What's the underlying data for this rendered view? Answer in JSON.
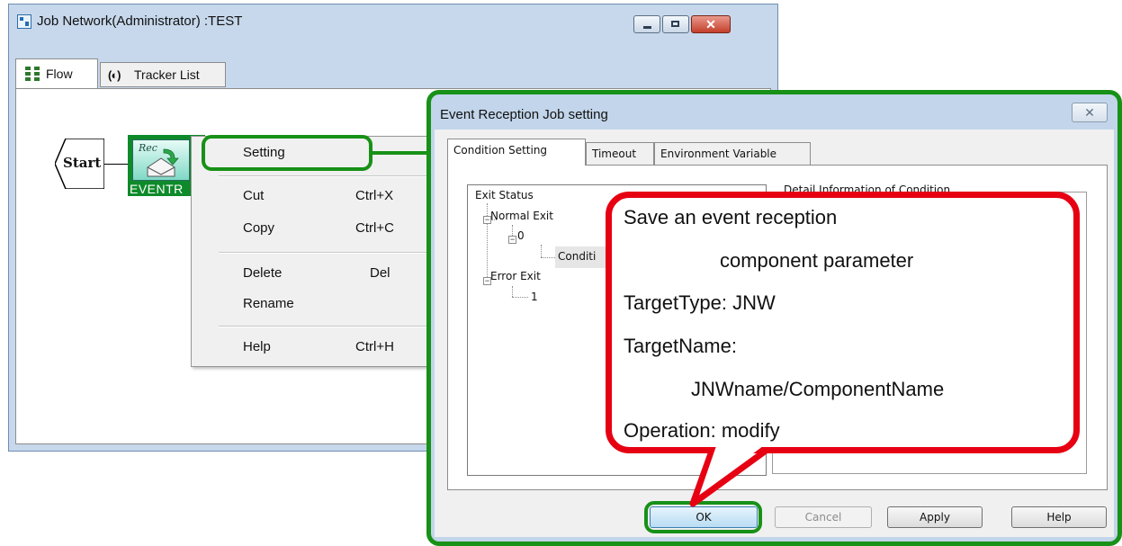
{
  "main_window": {
    "title": "Job Network(Administrator) :TEST",
    "close_glyph": "✕",
    "tabs": [
      {
        "label": "Flow"
      },
      {
        "label": "Tracker List",
        "icon_glyph": "(◐)"
      }
    ],
    "flow": {
      "start_label": "Start",
      "event_icon_text": "Rec",
      "event_label": "EVENTR"
    }
  },
  "context_menu": {
    "items": [
      {
        "label": "Setting",
        "shortcut": ""
      },
      {
        "label": "Cut",
        "shortcut": "Ctrl+X"
      },
      {
        "label": "Copy",
        "shortcut": "Ctrl+C"
      },
      {
        "label": "Delete",
        "shortcut": "Del"
      },
      {
        "label": "Rename",
        "shortcut": ""
      },
      {
        "label": "Help",
        "shortcut": "Ctrl+H"
      }
    ]
  },
  "dialog": {
    "title": "Event Reception Job setting",
    "close_glyph": "✕",
    "tabs": [
      {
        "label": "Condition Setting"
      },
      {
        "label": "Timeout"
      },
      {
        "label": "Environment Variable"
      }
    ],
    "tree": {
      "root": "Exit Status",
      "normal_exit": "Normal Exit",
      "normal_code": "0",
      "condition": "Conditi",
      "error_exit": "Error Exit",
      "error_code": "1"
    },
    "detail_label": "Detail Information of Condition",
    "buttons": {
      "ok": "OK",
      "cancel": "Cancel",
      "apply": "Apply",
      "help": "Help"
    }
  },
  "callout": {
    "lines": [
      "Save an event reception",
      "component parameter",
      "TargetType: JNW",
      "TargetName:",
      "JNWname/ComponentName",
      "Operation: modify"
    ]
  },
  "colors": {
    "highlight_green": "#179117",
    "callout_red": "#e60012",
    "node_green": "#0e8a2a"
  }
}
